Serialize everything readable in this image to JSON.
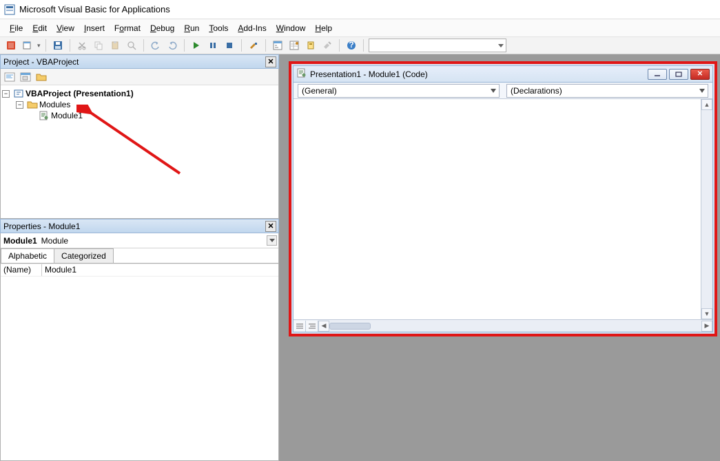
{
  "app": {
    "title": "Microsoft Visual Basic for Applications"
  },
  "menu": {
    "file": "File",
    "edit": "Edit",
    "view": "View",
    "insert": "Insert",
    "format": "Format",
    "debug": "Debug",
    "run": "Run",
    "tools": "Tools",
    "addins": "Add-Ins",
    "window": "Window",
    "help": "Help"
  },
  "project_panel": {
    "title": "Project - VBAProject",
    "tree": {
      "root": "VBAProject (Presentation1)",
      "modules_folder": "Modules",
      "module1": "Module1"
    }
  },
  "properties_panel": {
    "title": "Properties - Module1",
    "object_name": "Module1",
    "object_type": "Module",
    "tabs": {
      "alphabetic": "Alphabetic",
      "categorized": "Categorized"
    },
    "rows": {
      "name_key": "(Name)",
      "name_val": "Module1"
    }
  },
  "code_window": {
    "title": "Presentation1 - Module1 (Code)",
    "combo_left": "(General)",
    "combo_right": "(Declarations)"
  }
}
